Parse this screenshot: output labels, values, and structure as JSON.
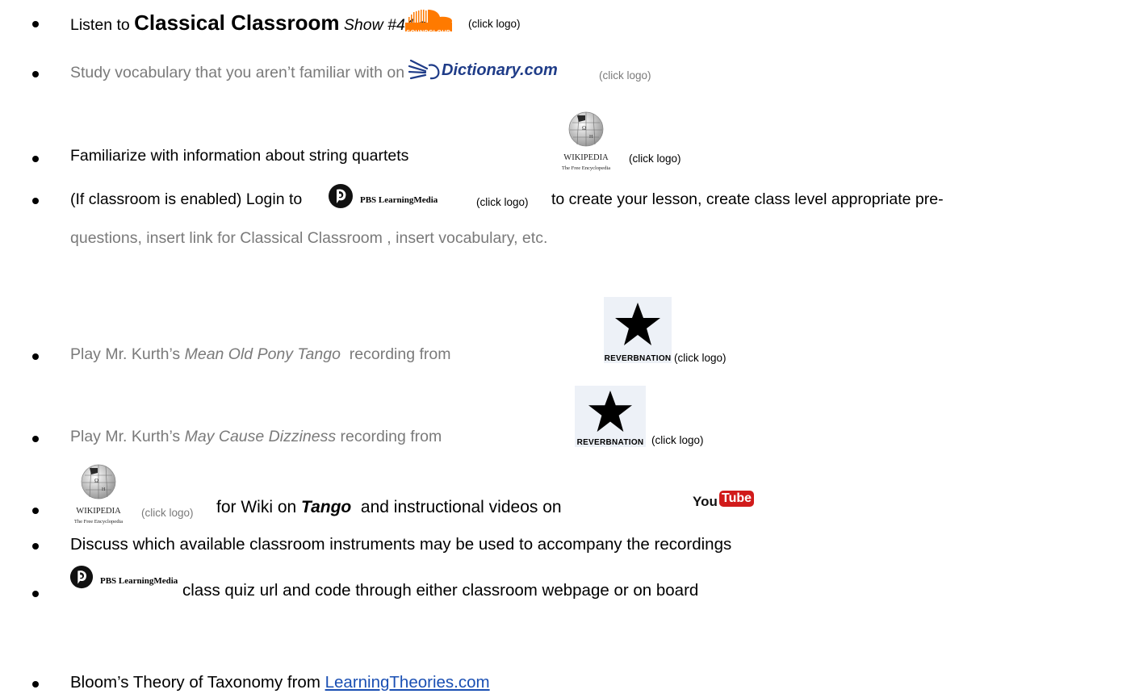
{
  "items": [
    {
      "pre": "Listen to",
      "title": "Classical Classroom",
      "show": "Show #44",
      "on": "on",
      "click": "(click logo)",
      "logo": "SOUNDCLOUD"
    },
    {
      "text": "Study vocabulary that you aren’t familiar with on",
      "logo": "Dictionary.com",
      "click": "(click logo)"
    },
    {
      "text": "Familiarize with information about string quartets",
      "logo_title": "WIKIPEDIA",
      "logo_sub": "The Free Encyclopedia",
      "click": "(click logo)"
    },
    {
      "pre": "(If classroom is enabled) Login to",
      "logo": "PBS LearningMedia",
      "click": "(click logo)",
      "post": "to create your lesson, create class level appropriate pre-",
      "cont": "questions, insert link for Classical Classroom , insert vocabulary, etc."
    },
    {
      "pre": "Play Mr. Kurth’s",
      "title": "Mean Old Pony Tango",
      "post": "recording from",
      "logo": "REVERBNATION",
      "click": "(click logo)"
    },
    {
      "pre": "Play Mr. Kurth’s",
      "title": "May Cause Dizziness",
      "post": "recording from",
      "logo": "REVERBNATION",
      "click": "(click logo)"
    },
    {
      "logo_title": "WIKIPEDIA",
      "logo_sub": "The Free Encyclopedia",
      "click": "(click logo)",
      "mid": "for Wiki on",
      "title": "Tango",
      "post": "and instructional videos on",
      "logo_you": "You",
      "logo_tube": "Tube"
    },
    {
      "text": "Discuss which available classroom instruments may be used to accompany the recordings"
    },
    {
      "logo": "PBS LearningMedia",
      "text": "class quiz url and code through either classroom webpage or on board"
    },
    {
      "pre": "Bloom’s Theory of Taxonomy from",
      "link": "LearningTheories.com"
    }
  ],
  "colors": {
    "text_gray": "#7a7a7a",
    "link": "#1a4fb3",
    "soundcloud": "#ff7a00",
    "youtube_red": "#d11b1b",
    "reverbnation_bg": "#edf1f7"
  }
}
